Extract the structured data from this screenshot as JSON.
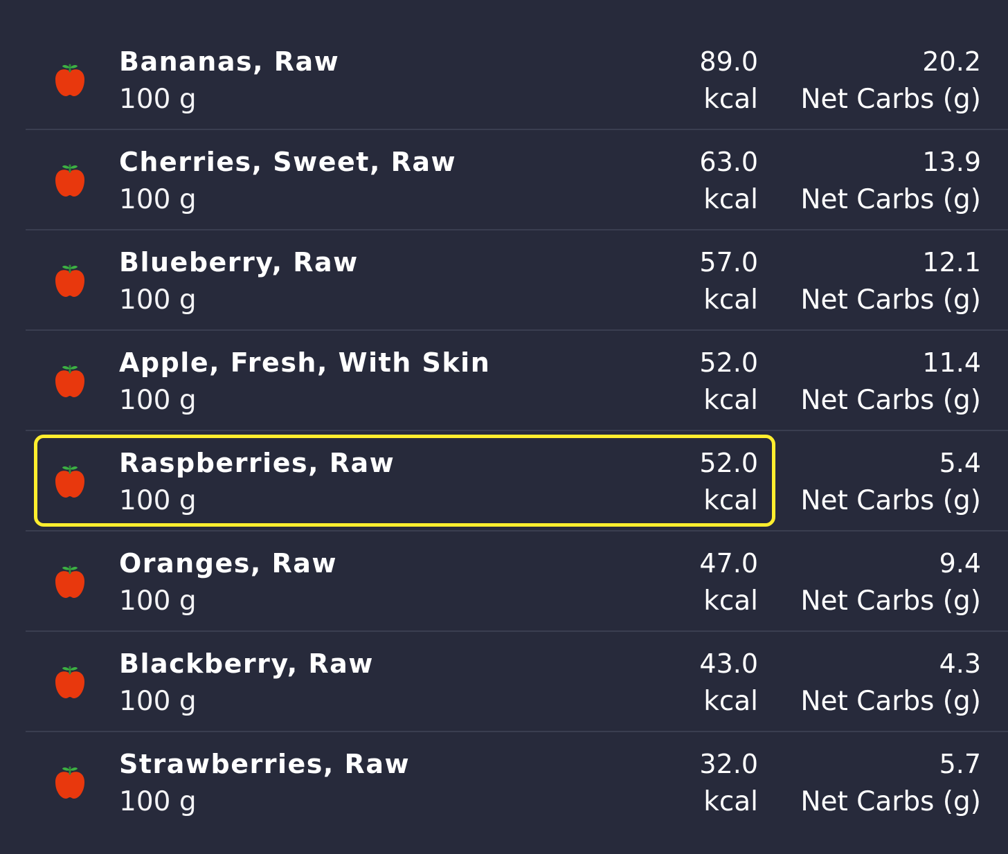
{
  "colors": {
    "background": "#272a3b",
    "divider": "#3a3e50",
    "text": "#ffffff",
    "highlight": "#ffee2e",
    "fruit_red": "#e8380d",
    "fruit_leaf": "#3cb043"
  },
  "highlighted_item_index": 4,
  "items": [
    {
      "icon": "apple-icon",
      "name": "Bananas, Raw",
      "serving": "100 g",
      "kcal": "89.0",
      "kcal_unit": "kcal",
      "carbs": "20.2",
      "carbs_unit": "Net Carbs (g)"
    },
    {
      "icon": "apple-icon",
      "name": "Cherries, Sweet, Raw",
      "serving": "100 g",
      "kcal": "63.0",
      "kcal_unit": "kcal",
      "carbs": "13.9",
      "carbs_unit": "Net Carbs (g)"
    },
    {
      "icon": "apple-icon",
      "name": "Blueberry, Raw",
      "serving": "100 g",
      "kcal": "57.0",
      "kcal_unit": "kcal",
      "carbs": "12.1",
      "carbs_unit": "Net Carbs (g)"
    },
    {
      "icon": "apple-icon",
      "name": "Apple, Fresh, With Skin",
      "serving": "100 g",
      "kcal": "52.0",
      "kcal_unit": "kcal",
      "carbs": "11.4",
      "carbs_unit": "Net Carbs (g)"
    },
    {
      "icon": "apple-icon",
      "name": "Raspberries, Raw",
      "serving": "100 g",
      "kcal": "52.0",
      "kcal_unit": "kcal",
      "carbs": "5.4",
      "carbs_unit": "Net Carbs (g)"
    },
    {
      "icon": "apple-icon",
      "name": "Oranges, Raw",
      "serving": "100 g",
      "kcal": "47.0",
      "kcal_unit": "kcal",
      "carbs": "9.4",
      "carbs_unit": "Net Carbs (g)"
    },
    {
      "icon": "apple-icon",
      "name": "Blackberry, Raw",
      "serving": "100 g",
      "kcal": "43.0",
      "kcal_unit": "kcal",
      "carbs": "4.3",
      "carbs_unit": "Net Carbs (g)"
    },
    {
      "icon": "apple-icon",
      "name": "Strawberries, Raw",
      "serving": "100 g",
      "kcal": "32.0",
      "kcal_unit": "kcal",
      "carbs": "5.7",
      "carbs_unit": "Net Carbs (g)"
    }
  ]
}
